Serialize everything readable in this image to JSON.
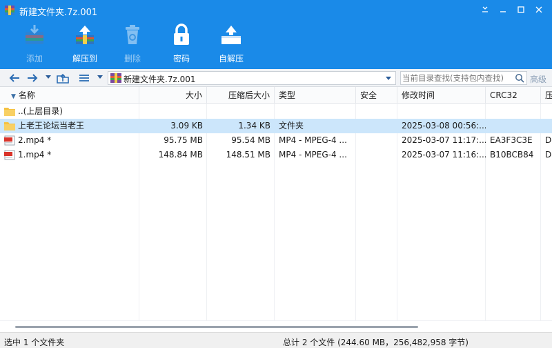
{
  "window": {
    "title": "新建文件夹.7z.001"
  },
  "toolbar": [
    {
      "label": "添加",
      "icon": "add-archive-icon",
      "enabled": false
    },
    {
      "label": "解压到",
      "icon": "extract-to-icon",
      "enabled": true
    },
    {
      "label": "删除",
      "icon": "delete-icon",
      "enabled": false
    },
    {
      "label": "密码",
      "icon": "password-lock-icon",
      "enabled": true
    },
    {
      "label": "自解压",
      "icon": "self-extract-icon",
      "enabled": true
    }
  ],
  "address": {
    "path": "新建文件夹.7z.001",
    "search_placeholder": "当前目录查找(支持包内查找)",
    "advanced_label": "高级"
  },
  "columns": {
    "name": "名称",
    "size": "大小",
    "packed": "压缩后大小",
    "type": "类型",
    "security": "安全",
    "modified": "修改时间",
    "crc": "CRC32",
    "extra": "压"
  },
  "rows": [
    {
      "name": "..(上层目录)",
      "icon": "folder-icon",
      "size": "",
      "packed": "",
      "type": "",
      "security": "",
      "modified": "",
      "crc": "",
      "extra": ""
    },
    {
      "name": "上老王论坛当老王",
      "icon": "folder-icon",
      "size": "3.09 KB",
      "packed": "1.34 KB",
      "type": "文件夹",
      "security": "",
      "modified": "2025-03-08 00:56:...",
      "crc": "",
      "extra": "",
      "selected": true
    },
    {
      "name": "2.mp4 *",
      "icon": "mp4-file-icon",
      "size": "95.75 MB",
      "packed": "95.54 MB",
      "type": "MP4 - MPEG-4 ...",
      "security": "",
      "modified": "2025-03-07 11:17:...",
      "crc": "EA3F3C3E",
      "extra": "De"
    },
    {
      "name": "1.mp4 *",
      "icon": "mp4-file-icon",
      "size": "148.84 MB",
      "packed": "148.51 MB",
      "type": "MP4 - MPEG-4 ...",
      "security": "",
      "modified": "2025-03-07 11:16:...",
      "crc": "B10BCB84",
      "extra": "De"
    }
  ],
  "status": {
    "left": "选中 1 个文件夹",
    "right": "总计 2 个文件 (244.60 MB，256,482,958 字节)"
  },
  "colors": {
    "accent": "#1a8ae8",
    "selection": "#cce6fb",
    "folder": "#f5c242",
    "mp4_badge": "#d9342b"
  }
}
